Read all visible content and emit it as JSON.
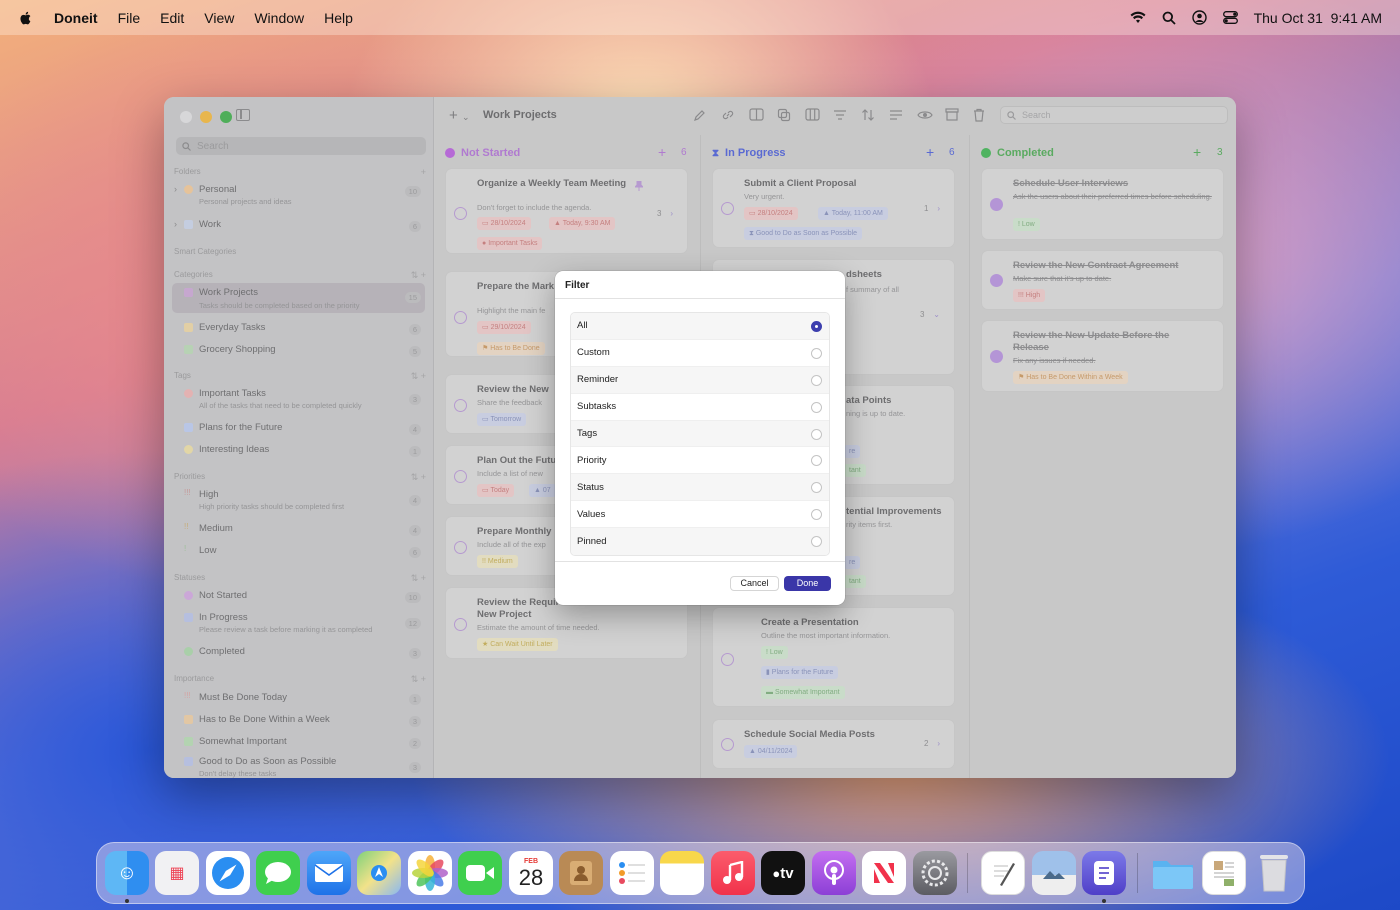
{
  "menubar": {
    "app_name": "Doneit",
    "menus": [
      "File",
      "Edit",
      "View",
      "Window",
      "Help"
    ],
    "clock": "Thu Oct 31  9:41 AM"
  },
  "toolbar": {
    "title": "Work Projects",
    "search_placeholder": "Search"
  },
  "sidebar": {
    "search_placeholder": "Search",
    "sections": {
      "folders": "Folders",
      "smart": "Smart Categories",
      "categories": "Categories",
      "tags": "Tags",
      "priorities": "Priorities",
      "statuses": "Statuses",
      "importance": "Importance"
    },
    "folders": [
      {
        "label": "Personal",
        "sub": "Personal projects and ideas",
        "count": "10"
      },
      {
        "label": "Work",
        "sub": "",
        "count": "6"
      }
    ],
    "categories": [
      {
        "label": "Work Projects",
        "sub": "Tasks should be completed based on the priority",
        "count": "15"
      },
      {
        "label": "Everyday Tasks",
        "sub": "",
        "count": "6"
      },
      {
        "label": "Grocery Shopping",
        "sub": "",
        "count": "5"
      }
    ],
    "tags": [
      {
        "label": "Important Tasks",
        "sub": "All of the tasks that need to be completed quickly",
        "count": "3"
      },
      {
        "label": "Plans for the Future",
        "sub": "",
        "count": "4"
      },
      {
        "label": "Interesting Ideas",
        "sub": "",
        "count": "1"
      }
    ],
    "priorities": [
      {
        "label": "High",
        "sub": "High priority tasks should be completed first",
        "count": "4"
      },
      {
        "label": "Medium",
        "sub": "",
        "count": "4"
      },
      {
        "label": "Low",
        "sub": "",
        "count": "6"
      }
    ],
    "statuses": [
      {
        "label": "Not Started",
        "sub": "",
        "count": "10"
      },
      {
        "label": "In Progress",
        "sub": "Please review a task before marking it as completed",
        "count": "12"
      },
      {
        "label": "Completed",
        "sub": "",
        "count": "3"
      }
    ],
    "importance": [
      {
        "label": "Must Be Done Today",
        "sub": "",
        "count": "1"
      },
      {
        "label": "Has to Be Done Within a Week",
        "sub": "",
        "count": "3"
      },
      {
        "label": "Somewhat Important",
        "sub": "",
        "count": "2"
      },
      {
        "label": "Good to Do as Soon as Possible",
        "sub": "Don't delay these tasks",
        "count": "3"
      }
    ]
  },
  "columns": {
    "not_started": {
      "title": "Not Started",
      "count": "6",
      "cards": [
        {
          "title": "Organize a Weekly Team Meeting",
          "desc": "Don't forget to include the agenda.",
          "meta": "3",
          "chips": [
            "28/10/2024",
            "Today, 9:30 AM",
            "Important Tasks"
          ]
        },
        {
          "title": "Prepare the Mark Presentation",
          "desc": "Highlight the main fe",
          "chips": [
            "29/10/2024",
            "Has to Be Done"
          ]
        },
        {
          "title": "Review the New",
          "desc": "Share the feedback",
          "chips": [
            "Tomorrow"
          ]
        },
        {
          "title": "Plan Out the Futu",
          "desc": "Include a list of new",
          "chips": [
            "Today",
            "07"
          ]
        },
        {
          "title": "Prepare Monthly",
          "desc": "Include all of the exp",
          "chips": [
            "Medium"
          ]
        },
        {
          "title": "Review the Requirements for the New Project",
          "desc": "Estimate the amount of time needed.",
          "chips": [
            "Can Wait Until Later"
          ]
        }
      ]
    },
    "in_progress": {
      "title": "In Progress",
      "count": "6",
      "cards": [
        {
          "title": "Submit a Client Proposal",
          "desc": "Very urgent.",
          "meta": "1",
          "chips": [
            "28/10/2024",
            "Today, 11:00 AM",
            "Good to Do as Soon as Possible"
          ]
        },
        {
          "title": "dsheets",
          "desc": "f summary of all",
          "meta": "3"
        },
        {
          "title": "ata Points",
          "desc": "ning is up to date.",
          "chips": [
            "re",
            "tant"
          ]
        },
        {
          "title": "tential Improvements",
          "desc": "rity items first.",
          "chips": [
            "re",
            "tant"
          ]
        },
        {
          "title": "Create a Presentation",
          "desc": "Outline the most important information.",
          "chips": [
            "Low",
            "Plans for the Future",
            "Somewhat Important"
          ]
        },
        {
          "title": "Schedule Social Media Posts",
          "desc": "",
          "meta": "2",
          "chips": [
            "04/11/2024"
          ]
        }
      ]
    },
    "completed": {
      "title": "Completed",
      "count": "3",
      "cards": [
        {
          "title": "Schedule User Interviews",
          "desc": "Ask the users about their preferred times before scheduling.",
          "chips": [
            "Low"
          ]
        },
        {
          "title": "Review the New Contract Agreement",
          "desc": "Make sure that it's up to date.",
          "chips": [
            "High"
          ]
        },
        {
          "title": "Review the New Update Before the Release",
          "desc": "Fix any issues if needed.",
          "chips": [
            "Has to Be Done Within a Week"
          ]
        }
      ]
    }
  },
  "dialog": {
    "title": "Filter",
    "options": [
      "All",
      "Custom",
      "Reminder",
      "Subtasks",
      "Tags",
      "Priority",
      "Status",
      "Values",
      "Pinned"
    ],
    "selected": "All",
    "cancel": "Cancel",
    "done": "Done"
  },
  "dock": {
    "apps": [
      "Finder",
      "Launchpad",
      "Safari",
      "Messages",
      "Mail",
      "Maps",
      "Photos",
      "FaceTime",
      "Calendar",
      "Contacts",
      "Reminders",
      "Notes",
      "Music",
      "TV",
      "Podcasts",
      "News",
      "System Settings",
      "TextEdit",
      "Preview",
      "Doneit",
      "Folder",
      "Document",
      "Trash"
    ],
    "calendar_month": "FEB",
    "calendar_day": "28",
    "tv_label": "tv"
  },
  "colors": {
    "accent": "#3a36a8",
    "not_started": "#b66ad6",
    "in_progress": "#4d5fd8",
    "completed": "#4fb360"
  }
}
